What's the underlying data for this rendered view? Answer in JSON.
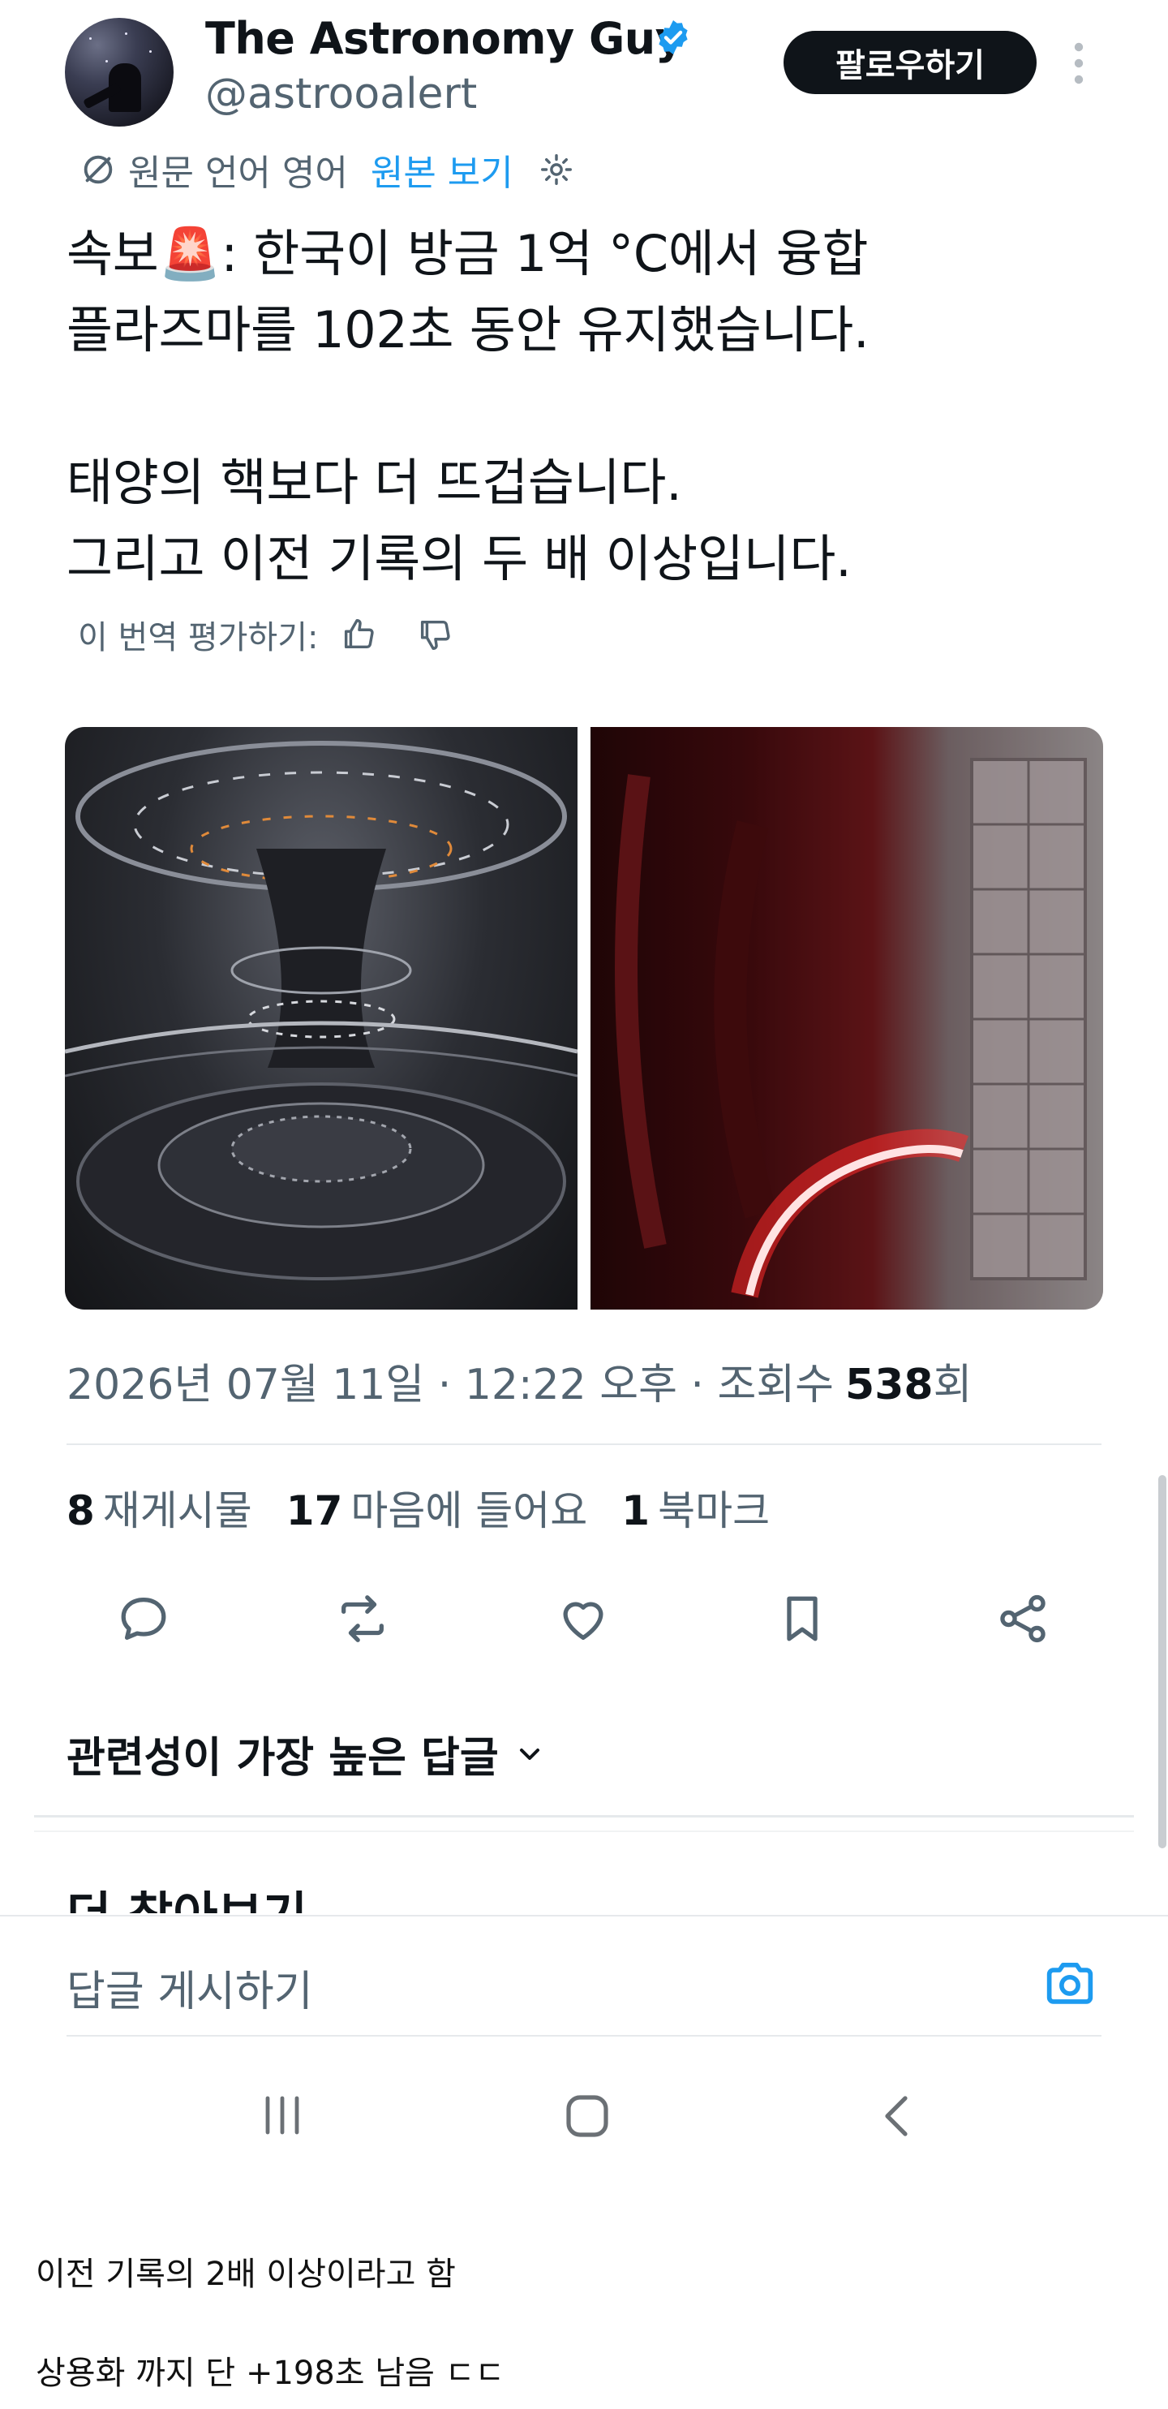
{
  "tweet": {
    "display_name": "The Astronomy Guy",
    "handle": "@astrooalert",
    "verified_color": "#1d9bf0",
    "follow_label": "팔로우하기",
    "translate": {
      "label": "원문 언어 영어",
      "link": "원본 보기"
    },
    "text": "속보🚨: 한국이 방금 1억 °C에서 융합\n플라즈마를 102초 동안 유지했습니다.\n\n태양의 핵보다 더 뜨겁습니다.\n그리고 이전 기록의 두 배 이상입니다.",
    "rate_label": "이 번역 평가하기:",
    "meta": {
      "datetime": "2026년 07월 11일 · 12:22 오후 · 조회수",
      "views": "538",
      "views_suffix": "회"
    },
    "stats": {
      "reposts_num": "8",
      "reposts_label": "재게시물",
      "likes_num": "17",
      "likes_label": "마음에 들어요",
      "bookmarks_num": "1",
      "bookmarks_label": "북마크"
    },
    "sort_label": "관련성이 가장 높은 답글",
    "discover_title": "더 찾아보기",
    "reply_placeholder": "답글 게시하기"
  },
  "captions": [
    "이전 기록의 2배 이상이라고 함",
    "상용화 까지 단 +198초 남음 ㄷㄷ"
  ],
  "icons": {
    "verified": "verified-badge-icon",
    "more": "more-vertical-icon",
    "translate": "translate-icon",
    "settings": "gear-icon",
    "thumbs_up": "thumbs-up-icon",
    "thumbs_down": "thumbs-down-icon",
    "reply": "reply-icon",
    "repost": "repost-icon",
    "like": "heart-icon",
    "bookmark": "bookmark-icon",
    "share": "share-icon",
    "chevron": "chevron-down-icon",
    "camera": "camera-icon"
  },
  "colors": {
    "accent": "#1d9bf0",
    "text": "#0f1419",
    "muted": "#536471"
  }
}
